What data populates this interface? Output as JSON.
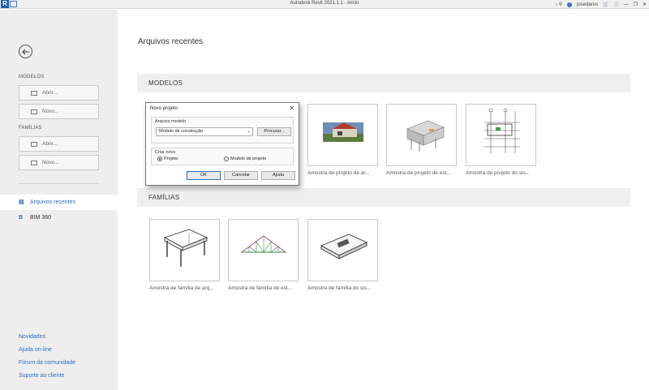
{
  "window": {
    "title": "Autodesk Revit 2021.1.1 - Início",
    "user": "josedaros"
  },
  "sidebar": {
    "models_heading": "MODELOS",
    "models_open": "Abrir...",
    "models_new": "Novo...",
    "families_heading": "FAMÍLIAS",
    "families_open": "Abrir...",
    "families_new": "Novo...",
    "nav": [
      {
        "label": "Arquivos recentes",
        "icon": "recent-files-icon"
      },
      {
        "label": "BIM 360",
        "icon": "bim360-icon"
      }
    ],
    "links": [
      "Novidades",
      "Ajuda on-line",
      "Fórum da comunidade",
      "Suporte ao cliente"
    ]
  },
  "main": {
    "title": "Arquivos recentes",
    "models_section": "MODELOS",
    "families_section": "FAMÍLIAS",
    "model_cards": [
      {
        "caption": "Amostra de projeto de ar..."
      },
      {
        "caption": "Amostra de projeto de est..."
      },
      {
        "caption": "Amostra de projeto do sis..."
      }
    ],
    "family_cards": [
      {
        "caption": "Amostra de família de arq..."
      },
      {
        "caption": "Amostra de família de est..."
      },
      {
        "caption": "Amostra de família do sis..."
      }
    ]
  },
  "dialog": {
    "title": "Novo projeto",
    "template_group": "Arquivo modelo",
    "template_value": "Modelo de construção",
    "browse": "Procurar...",
    "create_group": "Criar novo",
    "radio_project": "Projeto",
    "radio_template": "Modelo de projeto",
    "ok": "OK",
    "cancel": "Cancelar",
    "help": "Ajuda"
  },
  "colors": {
    "accent": "#2a6eb8",
    "sidebar_bg": "#eeeeee",
    "section_bg": "#efefef"
  }
}
